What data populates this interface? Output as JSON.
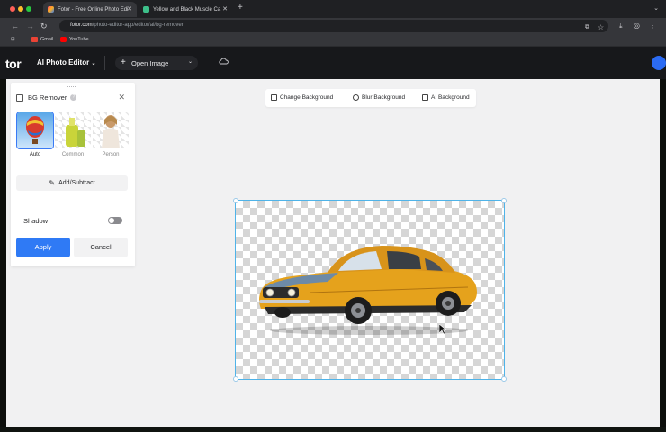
{
  "browser": {
    "tabs": [
      {
        "title": "Fotor - Free Online Photo Edi",
        "active": true
      },
      {
        "title": "Yellow and Black Muscle Ca",
        "active": false
      }
    ],
    "url_host": "fotor.com",
    "url_path": "/photo-editor-app/editor/ai/bg-remover",
    "bookmarks": [
      {
        "label": "Gmail"
      },
      {
        "label": "YouTube"
      }
    ]
  },
  "app": {
    "logo": "tor",
    "editor_menu": "AI Photo Editor",
    "open_image": "Open Image"
  },
  "panel": {
    "title": "BG Remover",
    "modes": [
      {
        "label": "Auto",
        "selected": true
      },
      {
        "label": "Common",
        "selected": false
      },
      {
        "label": "Person",
        "selected": false
      }
    ],
    "add_subtract": "Add/Subtract",
    "shadow_label": "Shadow",
    "shadow_on": false,
    "apply": "Apply",
    "cancel": "Cancel"
  },
  "actions": {
    "change_background": "Change Background",
    "blur_background": "Blur Background",
    "ai_background": "AI Background"
  },
  "colors": {
    "accent": "#2f7af5",
    "selection": "#4fb3e8",
    "car_body": "#e5a21c"
  }
}
